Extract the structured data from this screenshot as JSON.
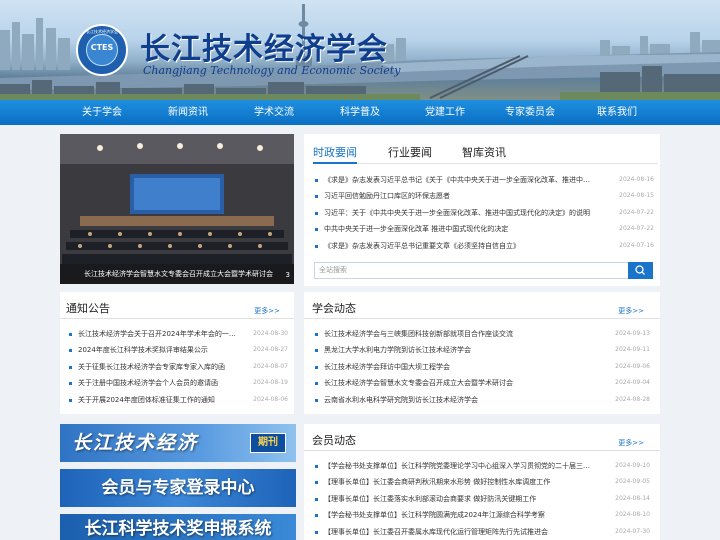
{
  "header": {
    "title": "长江技术经济学会",
    "subtitle": "Changjiang Technology and Economic Society",
    "logo_abbr": "CTES",
    "logo_ring": "长江技术经济学会"
  },
  "nav": {
    "items": [
      "关于学会",
      "新闻资讯",
      "学术交流",
      "科学普及",
      "党建工作",
      "专家委员会",
      "联系我们"
    ]
  },
  "slideshow": {
    "caption": "长江技术经济学会智慧水文专委会召开成立大会暨学术研讨会",
    "index": "3"
  },
  "news_tabs": {
    "tabs": [
      "时政要闻",
      "行业要闻",
      "智库资讯"
    ],
    "active": 0,
    "items": [
      {
        "title": "《求是》杂志发表习近平总书记《关于《中共中央关于进一步全面深化改革、推进中…",
        "date": "2024-08-16"
      },
      {
        "title": "习近平回信勉励丹江口库区的环保志愿者",
        "date": "2024-08-15"
      },
      {
        "title": "习近平：关于《中共中央关于进一步全面深化改革、推进中国式现代化的决定》的说明",
        "date": "2024-07-22"
      },
      {
        "title": "中共中央关于进一步全面深化改革 推进中国式现代化的决定",
        "date": "2024-07-22"
      },
      {
        "title": "《求是》杂志发表习近平总书记重要文章《必须坚持自信自立》",
        "date": "2024-07-16"
      }
    ],
    "search_placeholder": "全站搜索"
  },
  "notices": {
    "title": "通知公告",
    "more": "更多>>",
    "items": [
      {
        "title": "长江技术经济学会关于召开2024年学术年会的一…",
        "date": "2024-08-30"
      },
      {
        "title": "2024年度长江科学技术奖拟评审结果公示",
        "date": "2024-08-27"
      },
      {
        "title": "关于征集长江技术经济学会专家库专家入库的函",
        "date": "2024-08-07"
      },
      {
        "title": "关于注册中国技术经济学会个人会员的邀请函",
        "date": "2024-08-19"
      },
      {
        "title": "关于开展2024年度团体标准征集工作的通知",
        "date": "2024-08-06"
      }
    ]
  },
  "society_news": {
    "title": "学会动态",
    "more": "更多>>",
    "items": [
      {
        "title": "长江技术经济学会与三峡集团科技创新部就项目合作座谈交流",
        "date": "2024-09-13"
      },
      {
        "title": "黑龙江大学水利电力学院到访长江技术经济学会",
        "date": "2024-09-11"
      },
      {
        "title": "长江技术经济学会拜访中国大坝工程学会",
        "date": "2024-09-06"
      },
      {
        "title": "长江技术经济学会智慧水文专委会召开成立大会暨学术研讨会",
        "date": "2024-09-04"
      },
      {
        "title": "云南省水利水电科学研究院到访长江技术经济学会",
        "date": "2024-08-28"
      }
    ]
  },
  "member_news": {
    "title": "会员动态",
    "more": "更多>>",
    "items": [
      {
        "title": "【学会秘书处支撑单位】长江科学院党委理论学习中心组深入学习贯彻党的二十届三…",
        "date": "2024-09-10"
      },
      {
        "title": "【理事长单位】长江委会商研判秋汛期来水形势 做好控制性水库调度工作",
        "date": "2024-09-05"
      },
      {
        "title": "【理事长单位】长江委落实水利部滚动会商要求 做好防汛关键期工作",
        "date": "2024-08-14"
      },
      {
        "title": "【学会秘书处支撑单位】长江科学院圆满完成2024年江源综合科学考察",
        "date": "2024-08-10"
      },
      {
        "title": "【理事长单位】长江委召开委属水库现代化运行管理矩阵先行先试推进会",
        "date": "2024-07-30"
      }
    ]
  },
  "banners": {
    "journal": "长江技术经济",
    "journal_tag": "期刊",
    "login": "会员与专家登录中心",
    "award": "长江科学技术奖申报系统"
  },
  "colors": {
    "nav": "#0a6fc3",
    "accent": "#1a74c9",
    "title_blue": "#0f3e8c"
  }
}
